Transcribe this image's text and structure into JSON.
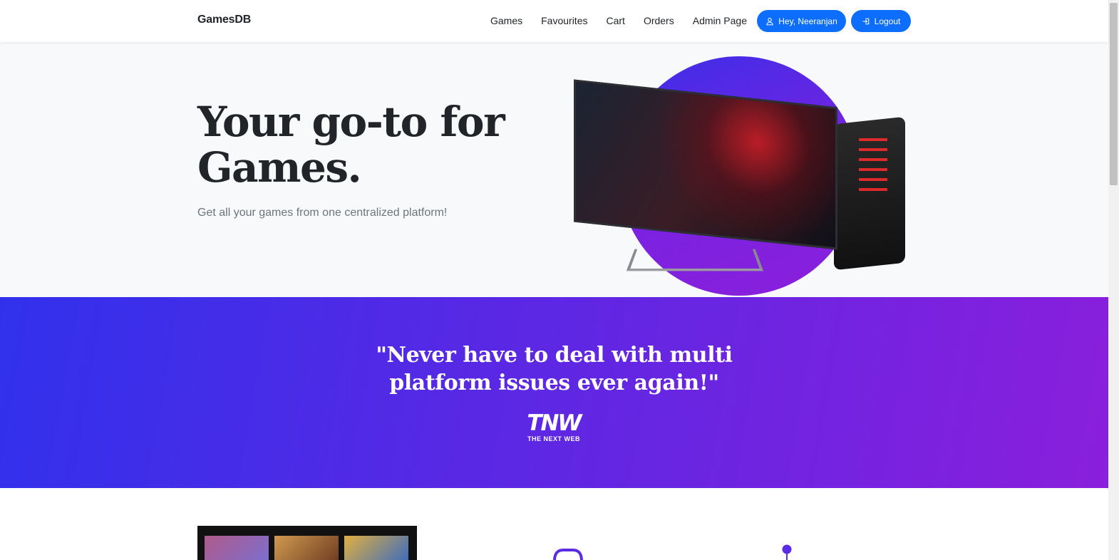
{
  "navbar": {
    "brand": "GamesDB",
    "links": [
      "Games",
      "Favourites",
      "Cart",
      "Orders",
      "Admin Page"
    ],
    "user_button": "Hey, Neeranjan",
    "logout_button": "Logout"
  },
  "hero": {
    "title": "Your go-to for Games.",
    "subtitle": "Get all your games from one centralized platform!"
  },
  "testimonial": {
    "quote": "\"Never have to deal with multi platform issues ever again!\"",
    "source_logo": "TNW",
    "source_name": "THE NEXT WEB"
  },
  "colors": {
    "primary": "#0d6efd",
    "banner_start": "#3131ec",
    "banner_end": "#8a1fdc"
  },
  "icons": [
    "user-icon",
    "login-icon",
    "gamepad-icon",
    "map-pin-icon"
  ]
}
